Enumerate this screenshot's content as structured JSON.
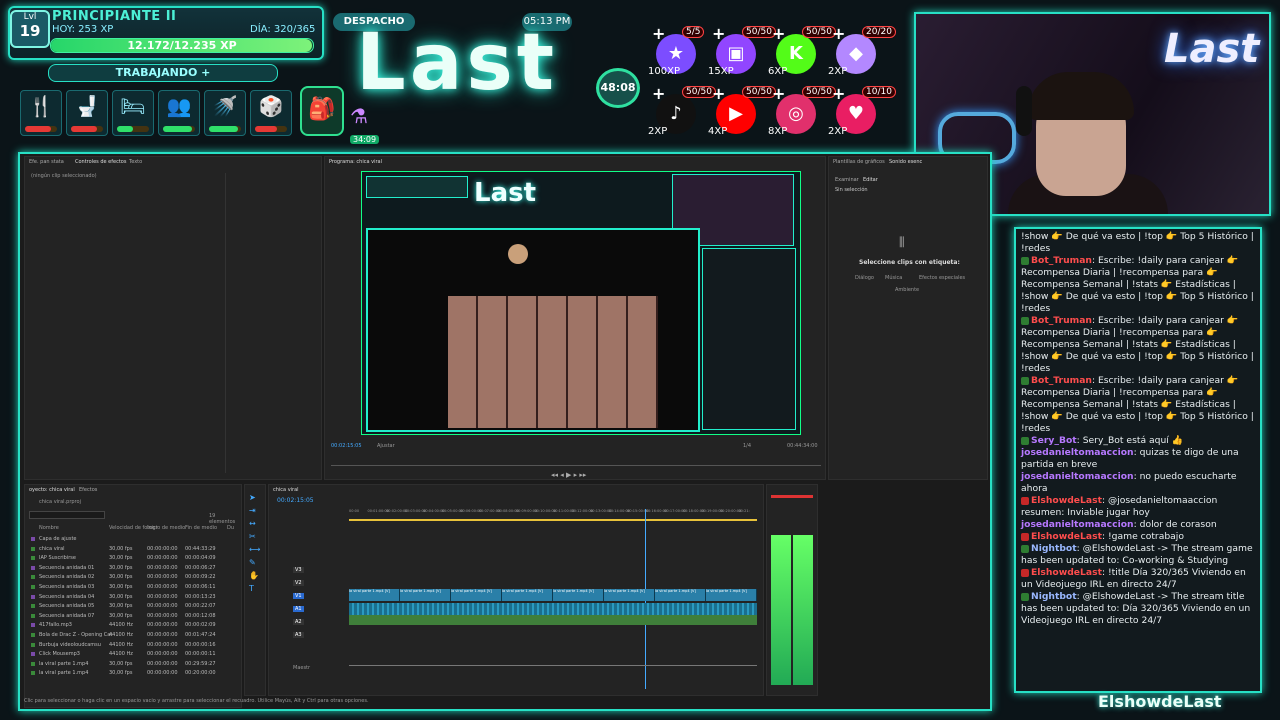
{
  "hud": {
    "level_label": "Lvl",
    "level": "19",
    "rank": "PRINCIPIANTE II",
    "today": "HOY: 253 XP",
    "day": "DÍA: 320/365",
    "xp_text": "12.172/12.235 XP",
    "xp_progress": 0.995,
    "working": "TRABAJANDO  +",
    "needs": [
      {
        "icon": "fork-knife-icon",
        "glyph": "🍴",
        "level": 0.8,
        "color": "#e53935"
      },
      {
        "icon": "toilet-icon",
        "glyph": "🚽",
        "level": 0.8,
        "color": "#e53935"
      },
      {
        "icon": "bed-icon",
        "glyph": "🛏",
        "level": 0.5,
        "color": "#2fe06a"
      },
      {
        "icon": "social-icon",
        "glyph": "👥",
        "level": 0.9,
        "color": "#2fe06a"
      },
      {
        "icon": "shower-icon",
        "glyph": "🚿",
        "level": 0.9,
        "color": "#2fe06a"
      },
      {
        "icon": "fun-icon",
        "glyph": "🎲",
        "level": 0.7,
        "color": "#e53935"
      }
    ],
    "backpack_glyph": "🎒",
    "potion_glyph": "⚗",
    "potion_value": "34:09"
  },
  "stream": {
    "despacho": "DESPACHO",
    "clock": "05:13 PM",
    "logo": "Last",
    "timer": "48:08",
    "footer": "ElshowdeLast"
  },
  "goals": [
    {
      "name": "star-goal",
      "glyph": "★",
      "count": "5/5",
      "xp": "100XP",
      "color": "#7c4dff"
    },
    {
      "name": "twitch-goal",
      "glyph": "▣",
      "count": "50/50",
      "xp": "15XP",
      "color": "#9146ff"
    },
    {
      "name": "kick-goal",
      "glyph": "K",
      "count": "50/50",
      "xp": "6XP",
      "color": "#53fc18"
    },
    {
      "name": "diamond-goal",
      "glyph": "◆",
      "count": "20/20",
      "xp": "2XP",
      "color": "#b388ff"
    },
    {
      "name": "tiktok-goal",
      "glyph": "♪",
      "count": "50/50",
      "xp": "2XP",
      "color": "#111111"
    },
    {
      "name": "youtube-goal",
      "glyph": "▶",
      "count": "50/50",
      "xp": "4XP",
      "color": "#ff0000"
    },
    {
      "name": "instagram-goal",
      "glyph": "◎",
      "count": "50/50",
      "xp": "8XP",
      "color": "#e1306c"
    },
    {
      "name": "heart-goal",
      "glyph": "♥",
      "count": "10/10",
      "xp": "2XP",
      "color": "#e91e63"
    }
  ],
  "webcam": {
    "neon_text": "Last"
  },
  "premiere": {
    "source_tabs": [
      "Efe. pan stata",
      "Controles de efectos",
      "Texto"
    ],
    "no_clip": "(ningún clip seleccionado)",
    "program_tab": "Programa: chica viral",
    "timecode_left": "00:02:15:05",
    "fit": "Ajustar",
    "zoom": "1/4",
    "timecode_right": "00:44:34:00",
    "right_tabs": [
      "Plantillas de gráficos",
      "Sonido esenc"
    ],
    "right_sub": [
      "Examinar",
      "Editar"
    ],
    "no_selection": "Sin selección",
    "select_label": "Seleccione clips con etiqueta:",
    "audio_types": [
      "Diálogo",
      "Música",
      "Efectos especiales",
      "Ambiente"
    ],
    "project_tab": "oyecto: chica viral",
    "effects_tab": "Efectos",
    "project_file": "chica viral.prproj",
    "items_count": "19 elementos",
    "columns": [
      "Nombre",
      "Velocidad de fotogr",
      "Inicio de medio",
      "Fin de medio",
      "Du"
    ],
    "project_rows": [
      [
        "Capa de ajuste",
        "",
        "",
        ""
      ],
      [
        "chica viral",
        "30,00 fps",
        "00:00:00:00",
        "00:44:33:29"
      ],
      [
        "IAP Suscribirse",
        "30,00 fps",
        "00:00:00:00",
        "00:00:04:09"
      ],
      [
        "Secuencia anidada 01",
        "30,00 fps",
        "00:00:00:00",
        "00:00:06:27"
      ],
      [
        "Secuencia anidada 02",
        "30,00 fps",
        "00:00:00:00",
        "00:00:09:22"
      ],
      [
        "Secuencia anidada 03",
        "30,00 fps",
        "00:00:00:00",
        "00:00:06:11"
      ],
      [
        "Secuencia anidada 04",
        "30,00 fps",
        "00:00:00:00",
        "00:00:13:23"
      ],
      [
        "Secuencia anidada 05",
        "30,00 fps",
        "00:00:00:00",
        "00:00:22:07"
      ],
      [
        "Secuencia anidada 07",
        "30,00 fps",
        "00:00:00:00",
        "00:00:12:08"
      ],
      [
        "417fallo.mp3",
        "44100 Hz",
        "00:00:00:00",
        "00:00:02:09"
      ],
      [
        "Bola de Drac Z - Opening Cat",
        "44100 Hz",
        "00:00:00:00",
        "00:01:47:24"
      ],
      [
        "Burbuja videoloudcamsu",
        "44100 Hz",
        "00:00:00:00",
        "00:00:00:16"
      ],
      [
        "Click Mousemp3",
        "44100 Hz",
        "00:00:00:00",
        "00:00:00:11"
      ],
      [
        "la viral parte 1.mp4",
        "30,00 fps",
        "00:00:00:00",
        "00:29:59:27"
      ],
      [
        "la viral parte 1.mp4",
        "30,00 fps",
        "00:00:00:00",
        "00:20:00:00"
      ]
    ],
    "sequence_tab": "chica viral",
    "seq_timecode": "00:02:15:05",
    "ruler": [
      "00:00",
      "00:01:00:00",
      "00:02:00:00",
      "00:03:00:00",
      "00:04:00:00",
      "00:05:00:00",
      "00:06:00:00",
      "00:07:00:00",
      "00:08:00:00",
      "00:09:00:00",
      "00:10:00:00",
      "00:11:00:00",
      "00:12:00:00",
      "00:13:00:00",
      "00:14:00:00",
      "00:15:00:00",
      "00:16:00:00",
      "00:17:00:00",
      "00:18:00:00",
      "00:19:00:00",
      "00:20:00:00",
      "00:21:"
    ],
    "tracks_v": [
      "V3",
      "V2",
      "V1"
    ],
    "tracks_a": [
      "A1",
      "A2",
      "A3"
    ],
    "master": "Maestr",
    "clips": [
      "la viral parte 1.mp4 [V]",
      "la viral parte 1.mp4 [V]",
      "la viral parte 1.mp4 [V]",
      "la viral parte 1.mp4 [V]",
      "la viral parte 1.mp4 [V]",
      "la viral parte 1.mp4 [V]",
      "la viral parte 1.mp4 [V]",
      "la viral parte 1.mp4 [V]"
    ],
    "status": "Clic para seleccionar o haga clic en un espacio vacío y arrastre para seleccionar el recuadro. Utilice Mayús, Alt y Ctrl para otras opciones.",
    "meter_scale": [
      "0",
      "-6",
      "-12",
      "-18",
      "-24",
      "-30",
      "-36",
      "-42",
      "-48",
      "-54"
    ]
  },
  "chat": [
    {
      "parts": [
        {
          "t": "!show 👉 De qué va esto | !top 👉 Top 5 Histórico | !redes",
          "c": "text"
        }
      ]
    },
    {
      "badge": "#2e7d32",
      "user": "Bot_Truman",
      "uc": "user-red",
      "parts": [
        {
          "t": ": Escribe: !daily para canjear 👉 Recompensa Diaria | !recompensa para 👉 Recompensa Semanal | !stats 👉 Estadísticas | !show 👉 De qué va esto | !top 👉 Top 5 Histórico | !redes",
          "c": "text"
        }
      ]
    },
    {
      "badge": "#2e7d32",
      "user": "Bot_Truman",
      "uc": "user-red",
      "parts": [
        {
          "t": ": Escribe: !daily para canjear 👉 Recompensa Diaria | !recompensa para 👉 Recompensa Semanal | !stats 👉 Estadísticas | !show 👉 De qué va esto | !top 👉 Top 5 Histórico | !redes",
          "c": "text"
        }
      ]
    },
    {
      "badge": "#2e7d32",
      "user": "Bot_Truman",
      "uc": "user-red",
      "parts": [
        {
          "t": ": Escribe: !daily para canjear 👉 Recompensa Diaria | !recompensa para 👉 Recompensa Semanal | !stats 👉 Estadísticas | !show 👉 De qué va esto | !top 👉 Top 5 Histórico | !redes",
          "c": "text"
        }
      ]
    },
    {
      "badge": "#2e7d32",
      "user": "Sery_Bot",
      "uc": "user-purple",
      "parts": [
        {
          "t": ": Sery_Bot está aquí 👍",
          "c": "text"
        }
      ]
    },
    {
      "user": "josedanieltomaaccion",
      "uc": "user-purple",
      "parts": [
        {
          "t": ": quizas te digo de una partida en breve",
          "c": "text"
        }
      ]
    },
    {
      "user": "josedanieltomaaccion",
      "uc": "user-purple",
      "parts": [
        {
          "t": ": no puedo escucharte ahora",
          "c": "text"
        }
      ]
    },
    {
      "badge": "#c62828",
      "user": "ElshowdeLast",
      "uc": "user-red",
      "parts": [
        {
          "t": ": @josedanieltomaaccion resumen: Inviable jugar hoy",
          "c": "text"
        }
      ]
    },
    {
      "user": "josedanieltomaaccion",
      "uc": "user-purple",
      "parts": [
        {
          "t": ": dolor de corason",
          "c": "text"
        }
      ]
    },
    {
      "badge": "#c62828",
      "user": "ElshowdeLast",
      "uc": "user-red",
      "parts": [
        {
          "t": ": !game cotrabajo",
          "c": "text"
        }
      ]
    },
    {
      "badge": "#2e7d32",
      "user": "Nightbot",
      "uc": "user-blue",
      "parts": [
        {
          "t": ": @ElshowdeLast -> The stream game has been updated to: Co-working & Studying",
          "c": "text"
        }
      ]
    },
    {
      "badge": "#c62828",
      "user": "ElshowdeLast",
      "uc": "user-red",
      "parts": [
        {
          "t": ": !title Día 320/365 Viviendo en un Videojuego IRL en directo 24/7",
          "c": "text"
        }
      ]
    },
    {
      "badge": "#2e7d32",
      "user": "Nightbot",
      "uc": "user-blue",
      "parts": [
        {
          "t": ": @ElshowdeLast -> The stream title has been updated to: Día 320/365 Viviendo en un Videojuego IRL en directo 24/7",
          "c": "text"
        }
      ]
    }
  ]
}
